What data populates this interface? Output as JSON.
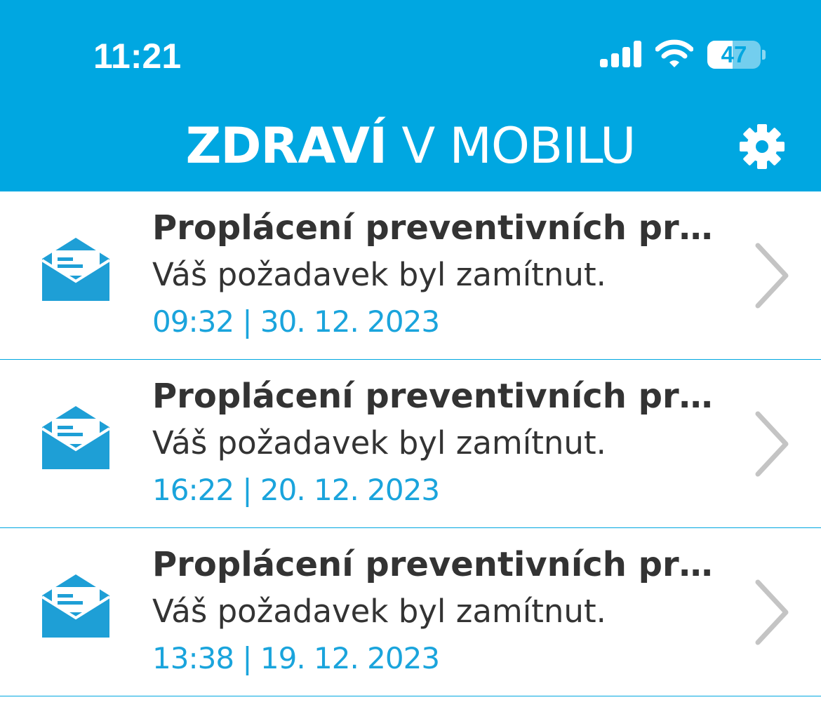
{
  "status_bar": {
    "time": "11:21",
    "battery_level": "47",
    "icons": [
      "signal-icon",
      "wifi-icon",
      "battery-icon"
    ]
  },
  "header": {
    "title_bold": "ZDRAVÍ",
    "title_regular": " V MOBILU",
    "settings_icon": "gear-icon",
    "background_color": "#00a7e1"
  },
  "messages": [
    {
      "title": "Proplácení preventivních progra...",
      "subtitle": "Váš požadavek byl zamítnut.",
      "datetime": "09:32 | 30. 12. 2023",
      "icon": "open-envelope-icon"
    },
    {
      "title": "Proplácení preventivních progra...",
      "subtitle": "Váš požadavek byl zamítnut.",
      "datetime": "16:22 | 20. 12. 2023",
      "icon": "open-envelope-icon"
    },
    {
      "title": "Proplácení preventivních progra...",
      "subtitle": "Váš požadavek byl zamítnut.",
      "datetime": "13:38 | 19. 12. 2023",
      "icon": "open-envelope-icon"
    }
  ],
  "colors": {
    "accent": "#00a7e1",
    "date_text": "#1aa4dc",
    "icon": "#1e9fd6",
    "chevron": "#c4c4c4",
    "title_text": "#333333"
  }
}
